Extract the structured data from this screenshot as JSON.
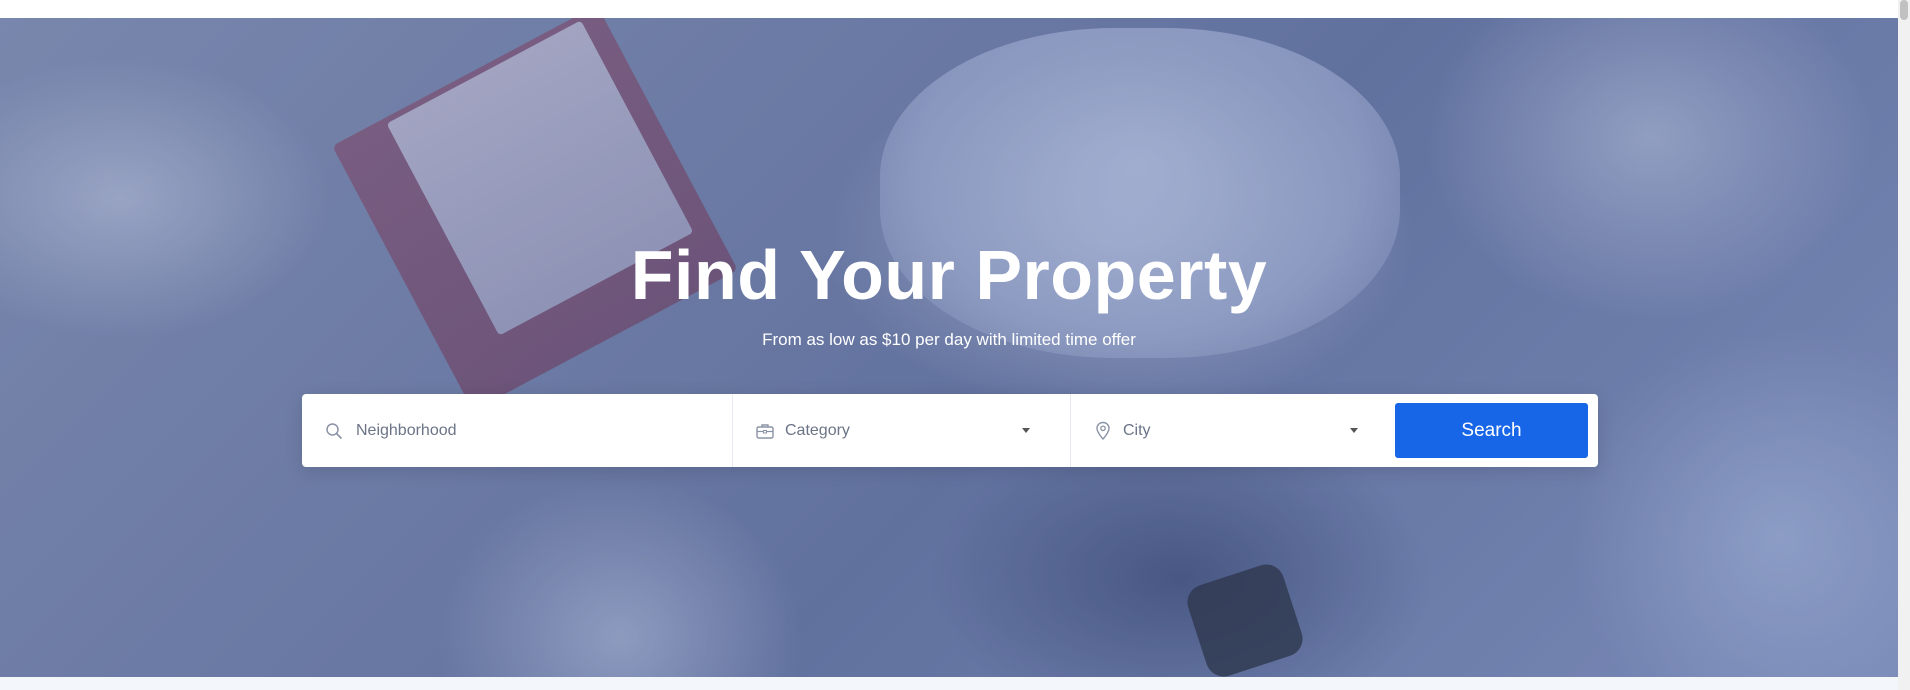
{
  "hero": {
    "title": "Find Your Property",
    "subtitle": "From as low as $10 per day with limited time offer"
  },
  "search": {
    "neighborhood_placeholder": "Neighborhood",
    "category_label": "Category",
    "city_label": "City",
    "button_label": "Search",
    "icons": {
      "neighborhood": "search-icon",
      "category": "briefcase-icon",
      "city": "map-pin-icon"
    }
  },
  "colors": {
    "accent": "#1766e8",
    "overlay": "#465a96"
  }
}
